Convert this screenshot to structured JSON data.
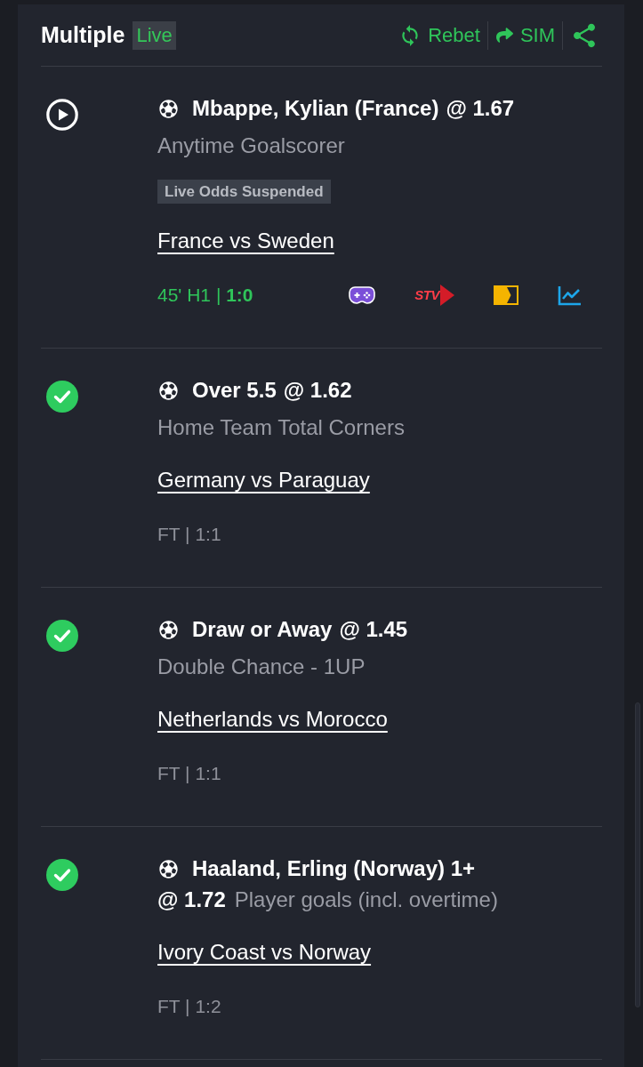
{
  "header": {
    "title": "Multiple",
    "badge": "Live",
    "actions": [
      {
        "kind": "rebet",
        "label": "Rebet"
      },
      {
        "kind": "sim",
        "label": "SIM"
      },
      {
        "kind": "share"
      }
    ]
  },
  "legs": [
    {
      "won": false,
      "kind": "stacked",
      "selection": "Mbappe, Kylian (France)",
      "odds": "@ 1.67",
      "market": "Anytime Goalscorer",
      "notice": "Live Odds Suspended",
      "match": "France vs Sweden",
      "result": "45' H1 | **1:0**",
      "live": true,
      "media": [
        {
          "kind": "game"
        },
        {
          "kind": "tv",
          "label": "STV"
        },
        {
          "kind": "stream"
        },
        {
          "kind": "stats"
        }
      ]
    },
    {
      "won": true,
      "kind": "stacked",
      "selection": "Over 5.5",
      "odds": "@ 1.62",
      "market": "Home Team Total Corners",
      "match": "Germany vs Paraguay",
      "result": "FT | 1:1",
      "live": false
    },
    {
      "won": true,
      "kind": "stacked",
      "selection": "Draw or Away",
      "odds": "@ 1.45",
      "market": "Double Chance - 1UP",
      "match": "Netherlands vs Morocco",
      "result": "FT | 1:1",
      "live": false
    },
    {
      "won": true,
      "kind": "inline",
      "selection": "Haaland, Erling (Norway) 1+",
      "odds": "@ 1.72",
      "market": "Player goals (incl. overtime)",
      "match": "Ivory Coast vs Norway",
      "result": "FT | 1:2",
      "live": false
    }
  ]
}
